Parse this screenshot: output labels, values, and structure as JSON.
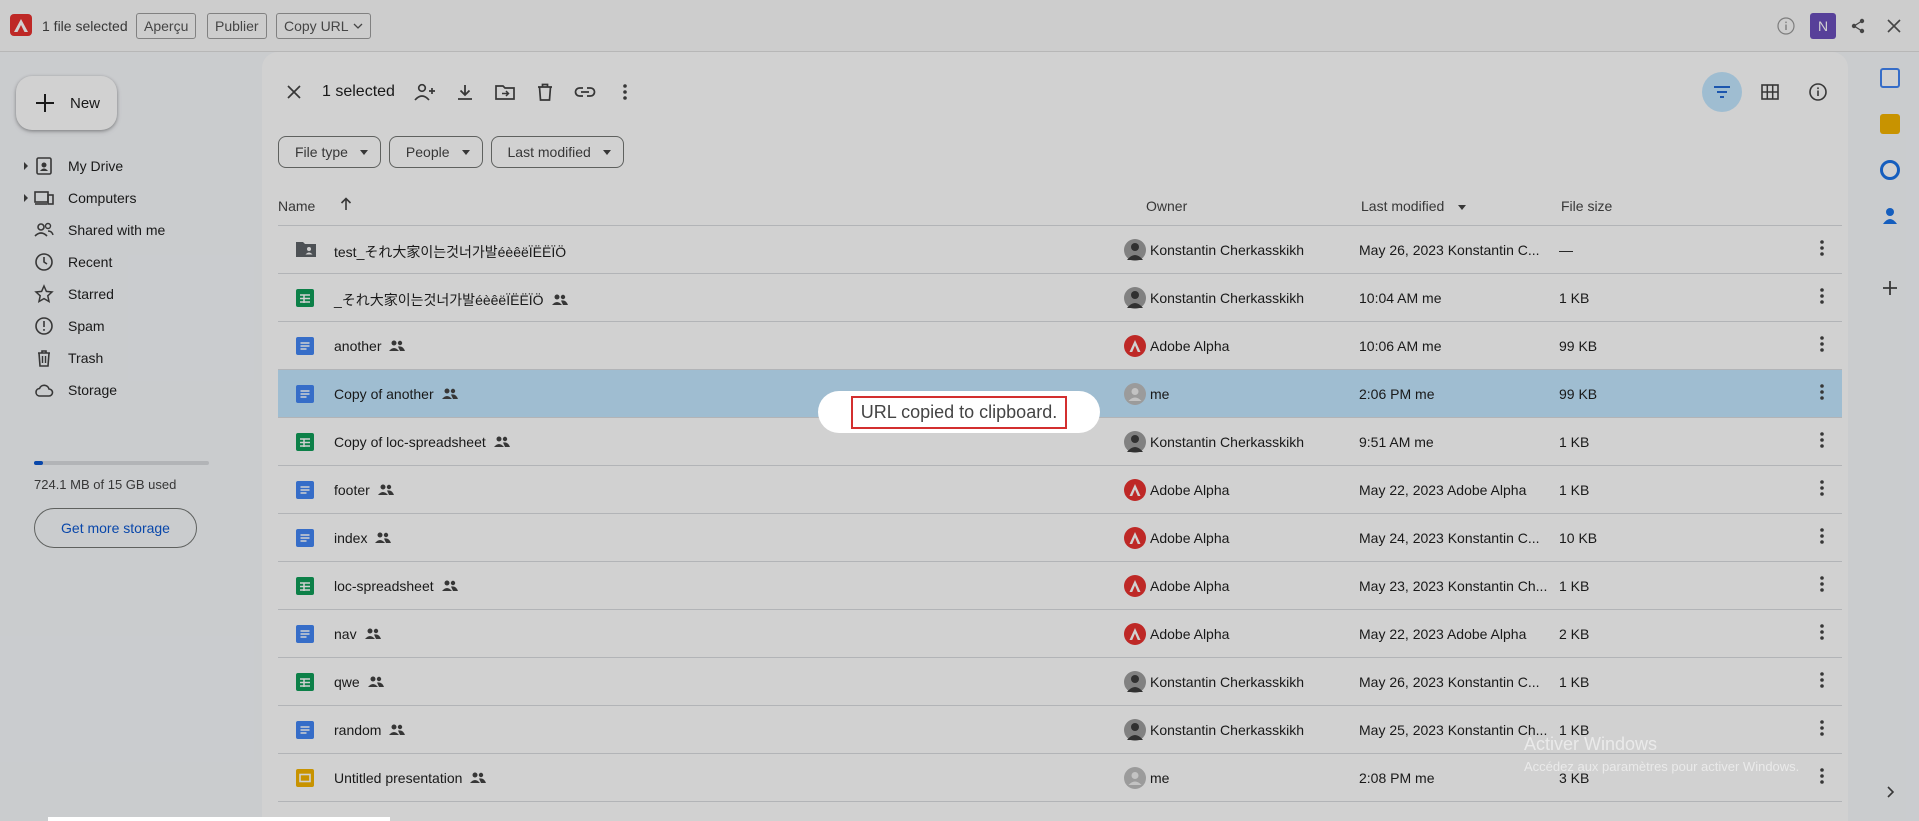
{
  "extension_bar": {
    "selected_text": "1 file selected",
    "buttons": [
      "Aperçu",
      "Publier",
      "Copy URL"
    ],
    "avatar_letter": "N"
  },
  "drive": {
    "new_label": "New",
    "nav": [
      {
        "label": "My Drive",
        "icon": "my-drive-icon",
        "expandable": true
      },
      {
        "label": "Computers",
        "icon": "computers-icon",
        "expandable": true
      },
      {
        "label": "Shared with me",
        "icon": "people-icon",
        "expandable": false
      },
      {
        "label": "Recent",
        "icon": "clock-icon",
        "expandable": false
      },
      {
        "label": "Starred",
        "icon": "star-icon",
        "expandable": false
      },
      {
        "label": "Spam",
        "icon": "spam-icon",
        "expandable": false
      },
      {
        "label": "Trash",
        "icon": "trash-icon",
        "expandable": false
      },
      {
        "label": "Storage",
        "icon": "cloud-icon",
        "expandable": false
      }
    ],
    "storage": {
      "used_text": "724.1 MB of 15 GB used",
      "fraction_used": 0.05,
      "button": "Get more storage"
    },
    "toolbar": {
      "selected_label": "1 selected"
    },
    "filters": [
      "File type",
      "People",
      "Last modified"
    ],
    "columns": {
      "name": "Name",
      "owner": "Owner",
      "modified": "Last modified",
      "size": "File size"
    },
    "files": [
      {
        "name": "test_それ大家이는것너가발éèêëÏËËÏÖ",
        "type": "shared-folder",
        "shared": false,
        "owner": "Konstantin Cherkasskikh",
        "avatar": "photo",
        "modified": "May 26, 2023 Konstantin C...",
        "size": "—",
        "selected": false
      },
      {
        "name": "_それ大家이는것너가발éèêëÏËËÏÖ",
        "type": "sheet",
        "shared": true,
        "owner": "Konstantin Cherkasskikh",
        "avatar": "photo",
        "modified": "10:04 AM me",
        "size": "1 KB",
        "selected": false
      },
      {
        "name": "another",
        "type": "doc",
        "shared": true,
        "owner": "Adobe Alpha",
        "avatar": "adobe",
        "modified": "10:06 AM me",
        "size": "99 KB",
        "selected": false
      },
      {
        "name": "Copy of another",
        "type": "doc",
        "shared": true,
        "owner": "me",
        "avatar": "default",
        "modified": "2:06 PM me",
        "size": "99 KB",
        "selected": true
      },
      {
        "name": "Copy of loc-spreadsheet",
        "type": "sheet",
        "shared": true,
        "owner": "Konstantin Cherkasskikh",
        "avatar": "photo",
        "modified": "9:51 AM me",
        "size": "1 KB",
        "selected": false
      },
      {
        "name": "footer",
        "type": "doc",
        "shared": true,
        "owner": "Adobe Alpha",
        "avatar": "adobe",
        "modified": "May 22, 2023 Adobe Alpha",
        "size": "1 KB",
        "selected": false
      },
      {
        "name": "index",
        "type": "doc",
        "shared": true,
        "owner": "Adobe Alpha",
        "avatar": "adobe",
        "modified": "May 24, 2023 Konstantin C...",
        "size": "10 KB",
        "selected": false
      },
      {
        "name": "loc-spreadsheet",
        "type": "sheet",
        "shared": true,
        "owner": "Adobe Alpha",
        "avatar": "adobe",
        "modified": "May 23, 2023 Konstantin Ch...",
        "size": "1 KB",
        "selected": false
      },
      {
        "name": "nav",
        "type": "doc",
        "shared": true,
        "owner": "Adobe Alpha",
        "avatar": "adobe",
        "modified": "May 22, 2023 Adobe Alpha",
        "size": "2 KB",
        "selected": false
      },
      {
        "name": "qwe",
        "type": "sheet",
        "shared": true,
        "owner": "Konstantin Cherkasskikh",
        "avatar": "photo",
        "modified": "May 26, 2023 Konstantin C...",
        "size": "1 KB",
        "selected": false
      },
      {
        "name": "random",
        "type": "doc",
        "shared": true,
        "owner": "Konstantin Cherkasskikh",
        "avatar": "photo",
        "modified": "May 25, 2023 Konstantin Ch...",
        "size": "1 KB",
        "selected": false
      },
      {
        "name": "Untitled presentation",
        "type": "slides",
        "shared": true,
        "owner": "me",
        "avatar": "default",
        "modified": "2:08 PM me",
        "size": "3 KB",
        "selected": false
      }
    ]
  },
  "toast": {
    "message": "URL copied to clipboard."
  },
  "watermark": {
    "line1": "Activer Windows",
    "line2": "Accédez aux paramètres pour activer Windows."
  },
  "colors": {
    "adobe_red": "#e8312f",
    "doc_blue": "#4285f4",
    "sheet_green": "#0f9d58",
    "slides_yellow": "#f4b400",
    "selected_row": "#c2e7ff",
    "accent": "#0b57d0",
    "avatar_purple": "#6b4fbb"
  }
}
